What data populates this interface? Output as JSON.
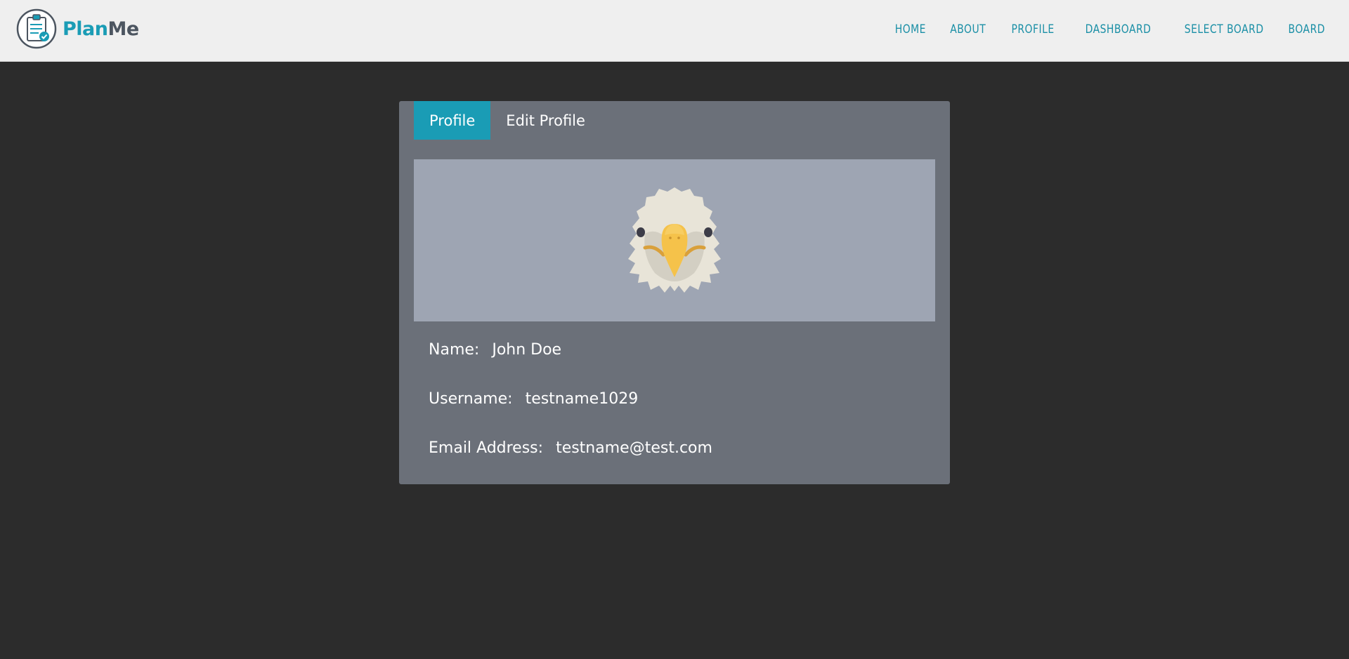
{
  "brand": {
    "name_part1": "Plan",
    "name_part2": "Me",
    "logo_icon": "clipboard-check-icon"
  },
  "nav": {
    "items": [
      {
        "label": "HOME"
      },
      {
        "label": "ABOUT"
      },
      {
        "label": "PROFILE"
      },
      {
        "label": "DASHBOARD"
      },
      {
        "label": "SELECT BOARD"
      },
      {
        "label": "BOARD"
      }
    ]
  },
  "tabs": [
    {
      "label": "Profile",
      "active": true
    },
    {
      "label": "Edit Profile",
      "active": false
    }
  ],
  "profile": {
    "avatar_icon": "eagle-avatar-icon",
    "name_label": "Name:",
    "name_value": "John Doe",
    "username_label": "Username:",
    "username_value": "testname1029",
    "email_label": "Email Address:",
    "email_value": "testname@test.com"
  },
  "colors": {
    "accent": "#1a9cb5",
    "navbar_bg": "#efefef",
    "page_bg": "#2c2c2c",
    "card_bg": "#6b7079",
    "banner_bg": "#9ea5b3"
  }
}
